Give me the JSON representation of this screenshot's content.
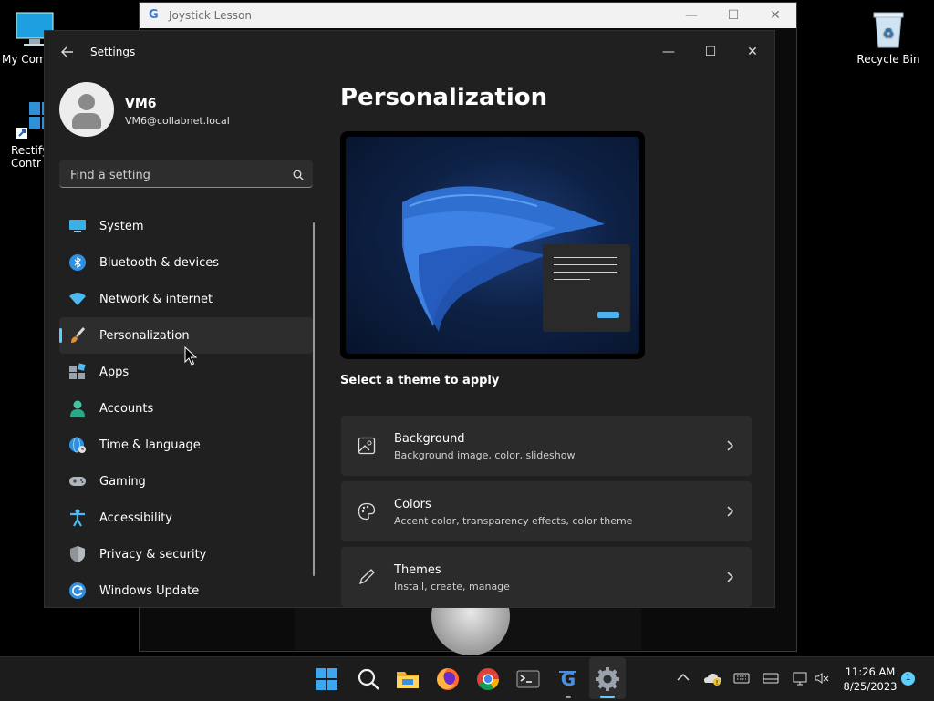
{
  "desktop": {
    "icons": [
      {
        "label": "My Com"
      },
      {
        "label": "Rectify Contr"
      },
      {
        "label": "Recycle Bin"
      }
    ]
  },
  "bg_window": {
    "title": "Joystick Lesson"
  },
  "settings": {
    "title": "Settings",
    "user": {
      "name": "VM6",
      "email": "VM6@collabnet.local"
    },
    "search": {
      "placeholder": "Find a setting"
    },
    "nav": [
      {
        "label": "System",
        "icon": "monitor-icon"
      },
      {
        "label": "Bluetooth & devices",
        "icon": "bluetooth-icon"
      },
      {
        "label": "Network & internet",
        "icon": "wifi-icon"
      },
      {
        "label": "Personalization",
        "icon": "brush-icon",
        "active": true
      },
      {
        "label": "Apps",
        "icon": "apps-icon"
      },
      {
        "label": "Accounts",
        "icon": "person-icon"
      },
      {
        "label": "Time & language",
        "icon": "globe-clock-icon"
      },
      {
        "label": "Gaming",
        "icon": "gamepad-icon"
      },
      {
        "label": "Accessibility",
        "icon": "accessibility-icon"
      },
      {
        "label": "Privacy & security",
        "icon": "shield-icon"
      },
      {
        "label": "Windows Update",
        "icon": "update-icon"
      }
    ],
    "page": {
      "title": "Personalization",
      "theme_label": "Select a theme to apply",
      "cards": [
        {
          "title": "Background",
          "subtitle": "Background image, color, slideshow",
          "icon": "image-icon"
        },
        {
          "title": "Colors",
          "subtitle": "Accent color, transparency effects, color theme",
          "icon": "palette-icon"
        },
        {
          "title": "Themes",
          "subtitle": "Install, create, manage",
          "icon": "pen-icon"
        }
      ]
    }
  },
  "taskbar": {
    "time": "11:26 AM",
    "date": "8/25/2023",
    "notification_count": "1"
  },
  "colors": {
    "accent": "#60cdff",
    "window_bg": "#202020",
    "card_bg": "#2b2b2b"
  }
}
